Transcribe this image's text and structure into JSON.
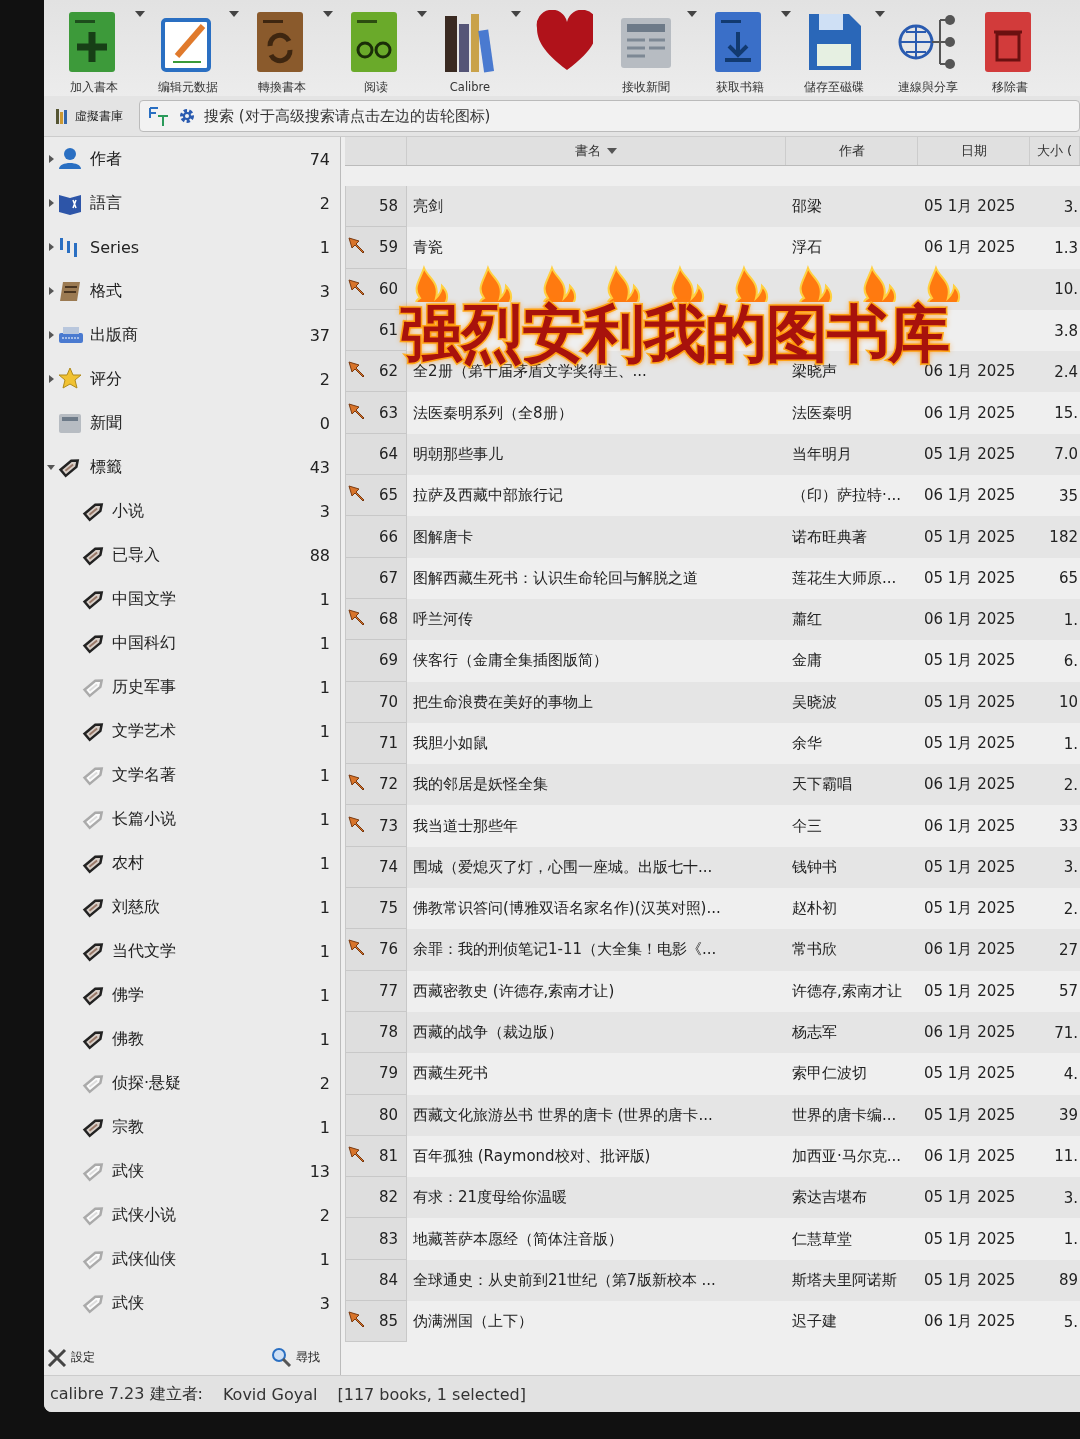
{
  "toolbar": {
    "items": [
      {
        "kind": "add",
        "label": "加入書本",
        "menu": true
      },
      {
        "kind": "edit",
        "label": "编辑元数据",
        "menu": true
      },
      {
        "kind": "convert",
        "label": "轉換書本",
        "menu": true
      },
      {
        "kind": "read",
        "label": "阅读",
        "menu": true
      },
      {
        "kind": "library",
        "label": "Calibre",
        "menu": true
      },
      {
        "kind": "donate",
        "menu": false
      },
      {
        "kind": "news",
        "label": "接收新聞",
        "menu": true
      },
      {
        "kind": "fetch",
        "label": "获取书籍",
        "menu": true
      },
      {
        "kind": "save",
        "label": "儲存至磁碟",
        "menu": true
      },
      {
        "kind": "share",
        "label": "連線與分享",
        "menu": false
      },
      {
        "kind": "remove",
        "label": "移除書",
        "menu": false
      }
    ]
  },
  "search_bar": {
    "virtual_library": "虛擬書庫",
    "placeholder": "搜索 (对于高级搜索请点击左边的齿轮图标)"
  },
  "sidebar": {
    "categories": [
      {
        "kind": "authors",
        "label": "作者",
        "count": "74",
        "expanded": false
      },
      {
        "kind": "languages",
        "label": "語言",
        "count": "2",
        "expanded": false
      },
      {
        "kind": "series",
        "label": "Series",
        "count": "1",
        "expanded": false
      },
      {
        "kind": "formats",
        "label": "格式",
        "count": "3",
        "expanded": false
      },
      {
        "kind": "publishers",
        "label": "出版商",
        "count": "37",
        "expanded": false
      },
      {
        "kind": "rating",
        "label": "评分",
        "count": "2",
        "expanded": false
      },
      {
        "kind": "news",
        "label": "新聞",
        "count": "0"
      },
      {
        "kind": "tags",
        "label": "標籤",
        "count": "43",
        "expanded": true,
        "children": [
          {
            "label": "小说",
            "count": "3",
            "faded": false
          },
          {
            "label": "已导入",
            "count": "88",
            "faded": false
          },
          {
            "label": "中国文学",
            "count": "1",
            "faded": false
          },
          {
            "label": "中国科幻",
            "count": "1",
            "faded": false
          },
          {
            "label": "历史军事",
            "count": "1",
            "faded": true
          },
          {
            "label": "文学艺术",
            "count": "1",
            "faded": false
          },
          {
            "label": "文学名著",
            "count": "1",
            "faded": true
          },
          {
            "label": "长篇小说",
            "count": "1",
            "faded": true
          },
          {
            "label": "农村",
            "count": "1",
            "faded": false
          },
          {
            "label": "刘慈欣",
            "count": "1",
            "faded": false
          },
          {
            "label": "当代文学",
            "count": "1",
            "faded": false
          },
          {
            "label": "佛学",
            "count": "1",
            "faded": false
          },
          {
            "label": "佛教",
            "count": "1",
            "faded": false
          },
          {
            "label": "侦探·悬疑",
            "count": "2",
            "faded": true
          },
          {
            "label": "宗教",
            "count": "1",
            "faded": false
          },
          {
            "label": "武侠",
            "count": "13",
            "faded": true
          },
          {
            "label": "武侠小说",
            "count": "2",
            "faded": true
          },
          {
            "label": "武侠仙侠",
            "count": "1",
            "faded": true
          },
          {
            "label": "武侠",
            "count": "3",
            "faded": true
          }
        ]
      }
    ],
    "settings_button": "設定",
    "find_button": "尋找"
  },
  "books": {
    "columns": [
      "書名",
      "作者",
      "日期",
      "大小 ("
    ],
    "rows": [
      {
        "num": "58",
        "title": "亮剑",
        "author": "邵梁",
        "date": "05 1月 2025",
        "size": "3.",
        "marked": false
      },
      {
        "num": "59",
        "title": "青瓷",
        "author": "浮石",
        "date": "06 1月 2025",
        "size": "1.3",
        "marked": true
      },
      {
        "num": "60",
        "size": "10.",
        "marked": true
      },
      {
        "num": "61",
        "size": "3.8",
        "marked": false
      },
      {
        "num": "62",
        "title": "全2册（第十届茅盾文学奖得主、...",
        "author": "梁晓声",
        "date": "06 1月 2025",
        "size": "2.4",
        "marked": true
      },
      {
        "num": "63",
        "title": "法医秦明系列（全8册）",
        "author": "法医秦明",
        "date": "06 1月 2025",
        "size": "15.",
        "marked": true
      },
      {
        "num": "64",
        "title": "明朝那些事儿",
        "author": "当年明月",
        "date": "05 1月 2025",
        "size": "7.0",
        "marked": false
      },
      {
        "num": "65",
        "title": "拉萨及西藏中部旅行记",
        "author": "（印）萨拉特·...",
        "date": "06 1月 2025",
        "size": "35",
        "marked": true
      },
      {
        "num": "66",
        "title": "图解唐卡",
        "author": "诺布旺典著",
        "date": "05 1月 2025",
        "size": "182",
        "marked": false
      },
      {
        "num": "67",
        "title": "图解西藏生死书：认识生命轮回与解脱之道",
        "author": "莲花生大师原...",
        "date": "05 1月 2025",
        "size": "65",
        "marked": false
      },
      {
        "num": "68",
        "title": "呼兰河传",
        "author": "蕭红",
        "date": "06 1月 2025",
        "size": "1.",
        "marked": true
      },
      {
        "num": "69",
        "title": "侠客行（金庸全集插图版简）",
        "author": "金庸",
        "date": "05 1月 2025",
        "size": "6.",
        "marked": false
      },
      {
        "num": "70",
        "title": "把生命浪费在美好的事物上",
        "author": "吴晓波",
        "date": "05 1月 2025",
        "size": "10",
        "marked": false
      },
      {
        "num": "71",
        "title": "我胆小如鼠",
        "author": "余华",
        "date": "05 1月 2025",
        "size": "1.",
        "marked": false
      },
      {
        "num": "72",
        "title": "我的邻居是妖怪全集",
        "author": "天下霸唱",
        "date": "06 1月 2025",
        "size": "2.",
        "marked": true
      },
      {
        "num": "73",
        "title": "我当道士那些年",
        "author": "仐三",
        "date": "06 1月 2025",
        "size": "33",
        "marked": true
      },
      {
        "num": "74",
        "title": "围城（爱熄灭了灯，心围一座城。出版七十...",
        "author": "钱钟书",
        "date": "05 1月 2025",
        "size": "3.",
        "marked": false
      },
      {
        "num": "75",
        "title": "佛教常识答问(博雅双语名家名作)(汉英对照)...",
        "author": "赵朴初",
        "date": "05 1月 2025",
        "size": "2.",
        "marked": false
      },
      {
        "num": "76",
        "title": "余罪：我的刑侦笔记1-11（大全集！电影《...",
        "author": "常书欣",
        "date": "06 1月 2025",
        "size": "27",
        "marked": true
      },
      {
        "num": "77",
        "title": "西藏密教史 (许德存,索南才让)",
        "author": "许德存,索南才让",
        "date": "05 1月 2025",
        "size": "57",
        "marked": false
      },
      {
        "num": "78",
        "title": "西藏的战争（裁边版）",
        "author": "杨志军",
        "date": "06 1月 2025",
        "size": "71.",
        "marked": false
      },
      {
        "num": "79",
        "title": "西藏生死书",
        "author": "索甲仁波切",
        "date": "05 1月 2025",
        "size": "4.",
        "marked": false
      },
      {
        "num": "80",
        "title": "西藏文化旅游丛书 世界的唐卡 (世界的唐卡...",
        "author": "世界的唐卡编...",
        "date": "05 1月 2025",
        "size": "39",
        "marked": false
      },
      {
        "num": "81",
        "title": "百年孤独 (Raymond校对、批评版)",
        "author": "加西亚·马尔克...",
        "date": "06 1月 2025",
        "size": "11.",
        "marked": true
      },
      {
        "num": "82",
        "title": "有求：21度母给你温暖",
        "author": "索达吉堪布",
        "date": "05 1月 2025",
        "size": "3.",
        "marked": false
      },
      {
        "num": "83",
        "title": "地藏菩萨本愿经（简体注音版）",
        "author": "仁慧草堂",
        "date": "05 1月 2025",
        "size": "1.",
        "marked": false
      },
      {
        "num": "84",
        "title": "全球通史：从史前到21世纪（第7版新校本 ...",
        "author": "斯塔夫里阿诺斯",
        "date": "05 1月 2025",
        "size": "89",
        "marked": false
      },
      {
        "num": "85",
        "title": "伪满洲国（上下）",
        "author": "迟子建",
        "date": "06 1月 2025",
        "size": "5.",
        "marked": true
      }
    ]
  },
  "status_bar": {
    "version": "calibre 7.23 建立者:",
    "author": "Kovid Goyal",
    "summary": "[117 books, 1 selected]"
  },
  "overlay_title": "强烈安利我的图书库"
}
